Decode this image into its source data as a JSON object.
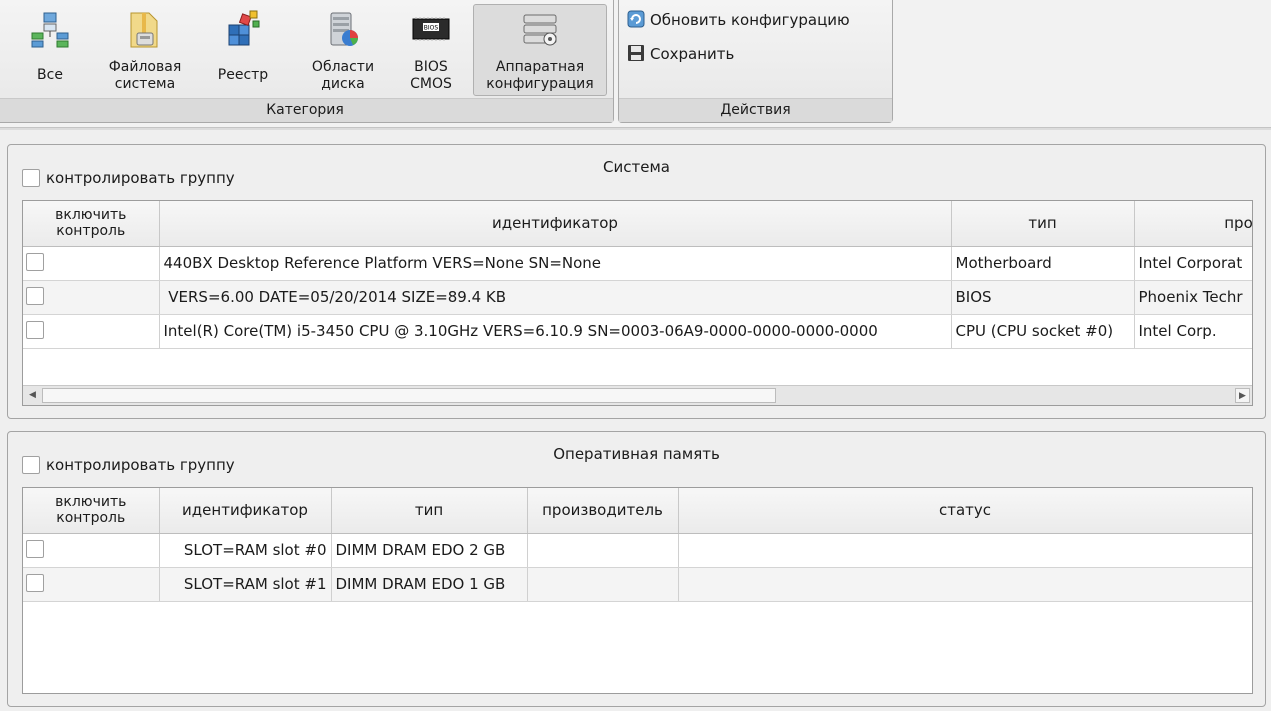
{
  "ribbon": {
    "category_group": {
      "label": "Категория",
      "buttons": [
        {
          "label1": "Все",
          "label2": "",
          "icon": "all-icon"
        },
        {
          "label1": "Файловая",
          "label2": "система",
          "icon": "filesystem-icon"
        },
        {
          "label1": "Реестр",
          "label2": "",
          "icon": "registry-icon"
        },
        {
          "label1": "Области",
          "label2": "диска",
          "icon": "disk-areas-icon"
        },
        {
          "label1": "BIOS",
          "label2": "CMOS",
          "icon": "bios-chip-icon"
        },
        {
          "label1": "Аппаратная",
          "label2": "конфигурация",
          "icon": "hardware-config-icon",
          "active": true
        }
      ],
      "bios_chip_text": "BIOS"
    },
    "actions_group": {
      "label": "Действия",
      "refresh_label": "Обновить конфигурацию",
      "save_label": "Сохранить"
    }
  },
  "system_panel": {
    "title": "Система",
    "group_check_label": "контролировать группу",
    "columns": {
      "enable": [
        "включить",
        "контроль"
      ],
      "identifier": "идентификатор",
      "type": "тип",
      "manufacturer": "произво"
    },
    "rows": [
      {
        "identifier": "440BX Desktop Reference Platform VERS=None SN=None",
        "type": "Motherboard",
        "manufacturer": "Intel Corporat"
      },
      {
        "identifier": " VERS=6.00 DATE=05/20/2014 SIZE=89.4 KB",
        "type": "BIOS",
        "manufacturer": "Phoenix Techr"
      },
      {
        "identifier": "Intel(R) Core(TM) i5-3450 CPU @ 3.10GHz VERS=6.10.9 SN=0003-06A9-0000-0000-0000-0000",
        "type": "CPU (CPU socket #0)",
        "manufacturer": "Intel Corp."
      }
    ]
  },
  "memory_panel": {
    "title": "Оперативная память",
    "group_check_label": "контролировать группу",
    "columns": {
      "enable": [
        "включить",
        "контроль"
      ],
      "identifier": "идентификатор",
      "type": "тип",
      "manufacturer": "производитель",
      "status": "статус"
    },
    "rows": [
      {
        "identifier": "SLOT=RAM slot #0",
        "type": "DIMM DRAM EDO 2 GB",
        "manufacturer": "",
        "status": ""
      },
      {
        "identifier": "SLOT=RAM slot #1",
        "type": "DIMM DRAM EDO 1 GB",
        "manufacturer": "",
        "status": ""
      }
    ]
  }
}
